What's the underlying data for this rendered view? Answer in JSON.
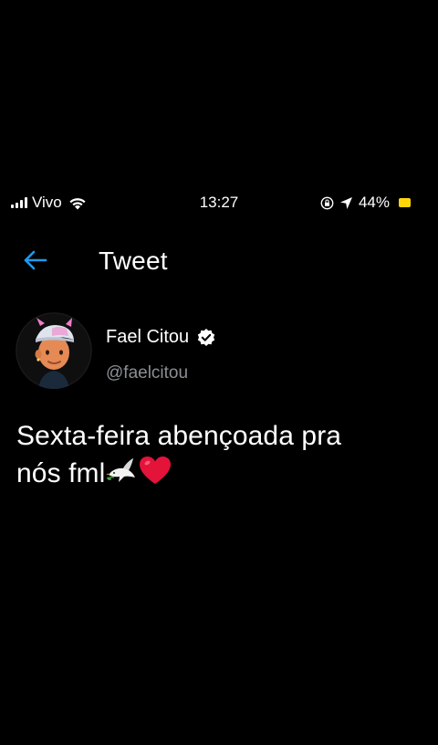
{
  "status_bar": {
    "carrier": "Vivo",
    "time": "13:27",
    "battery": "44%",
    "battery_color": "#ffd60a"
  },
  "header": {
    "title": "Tweet",
    "back_icon": "back-arrow-icon",
    "accent_color": "#1d9bf0"
  },
  "tweet": {
    "author_name": "Fael Citou",
    "author_handle": "@faelcitou",
    "verified": true,
    "text_line1": "Sexta-feira abençoada pra",
    "text_line2": "nós fml",
    "emojis": [
      "dove",
      "red-heart"
    ]
  }
}
